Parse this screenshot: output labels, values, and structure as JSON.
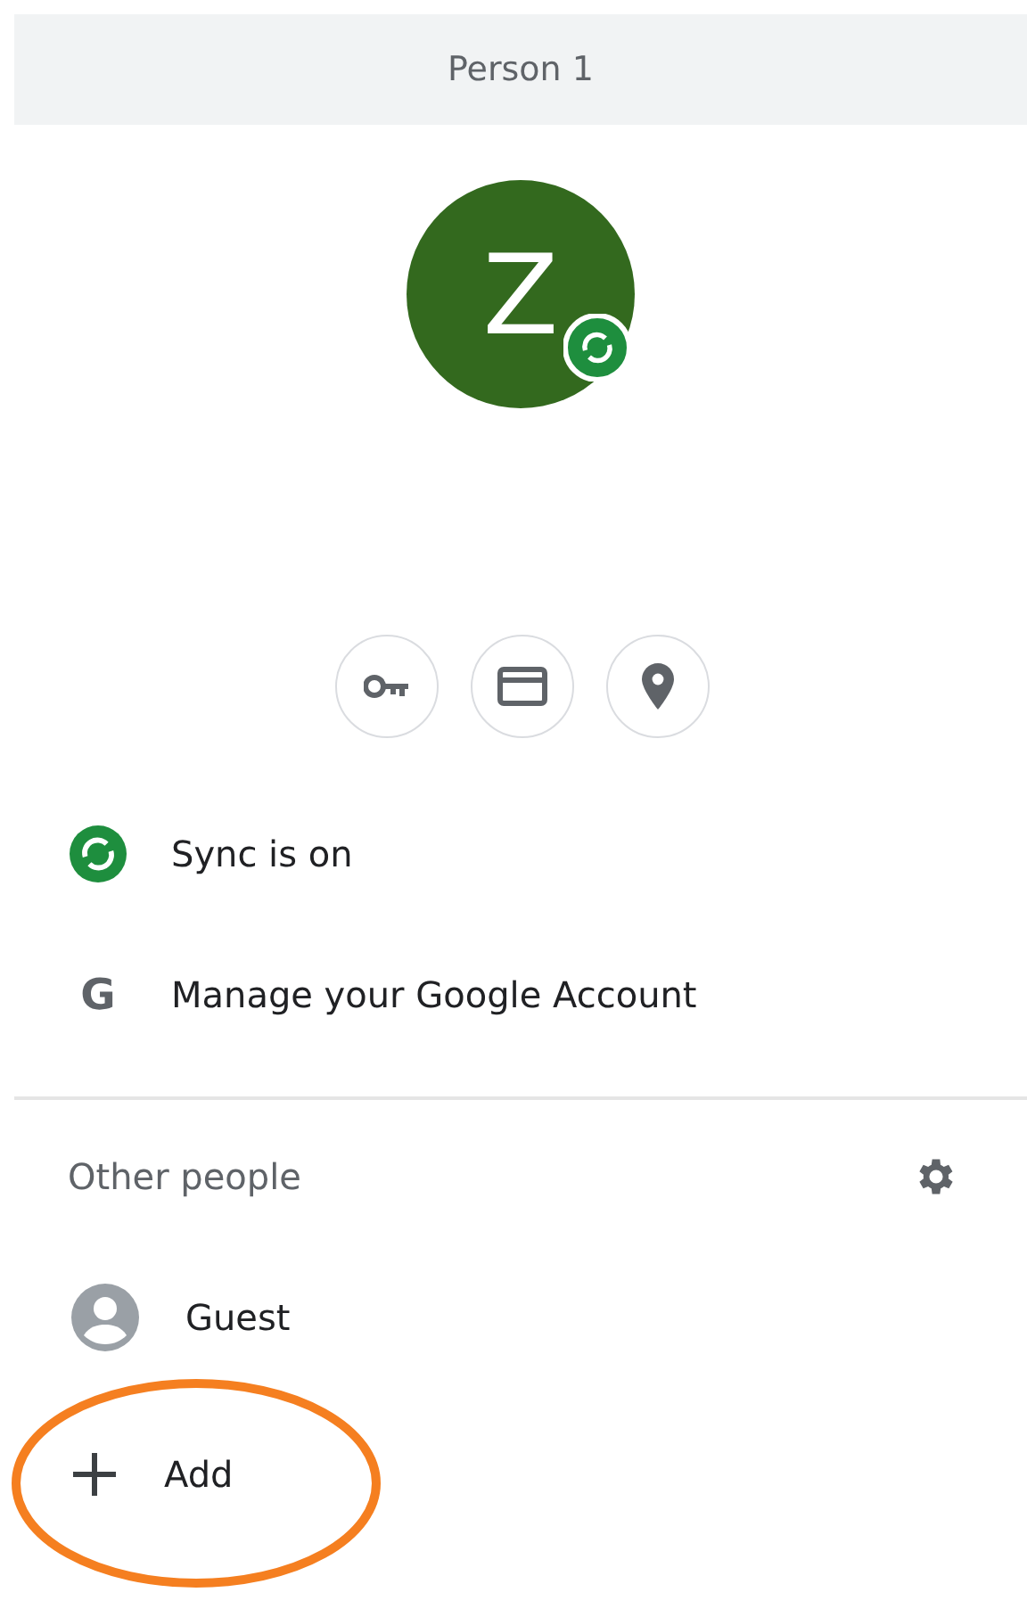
{
  "header": {
    "title": "Person 1"
  },
  "profile": {
    "initial": "Z",
    "sync_badge": true
  },
  "quick_actions": [
    {
      "kind": "key"
    },
    {
      "kind": "card"
    },
    {
      "kind": "pin"
    }
  ],
  "menu": [
    {
      "kind": "sync",
      "label": "Sync is on"
    },
    {
      "kind": "google",
      "icon_text": "G",
      "label": "Manage your Google Account"
    }
  ],
  "other_people": {
    "heading": "Other people",
    "items": [
      {
        "kind": "guest",
        "label": "Guest",
        "highlighted": false
      },
      {
        "kind": "add",
        "label": "Add",
        "highlighted": true
      }
    ]
  }
}
